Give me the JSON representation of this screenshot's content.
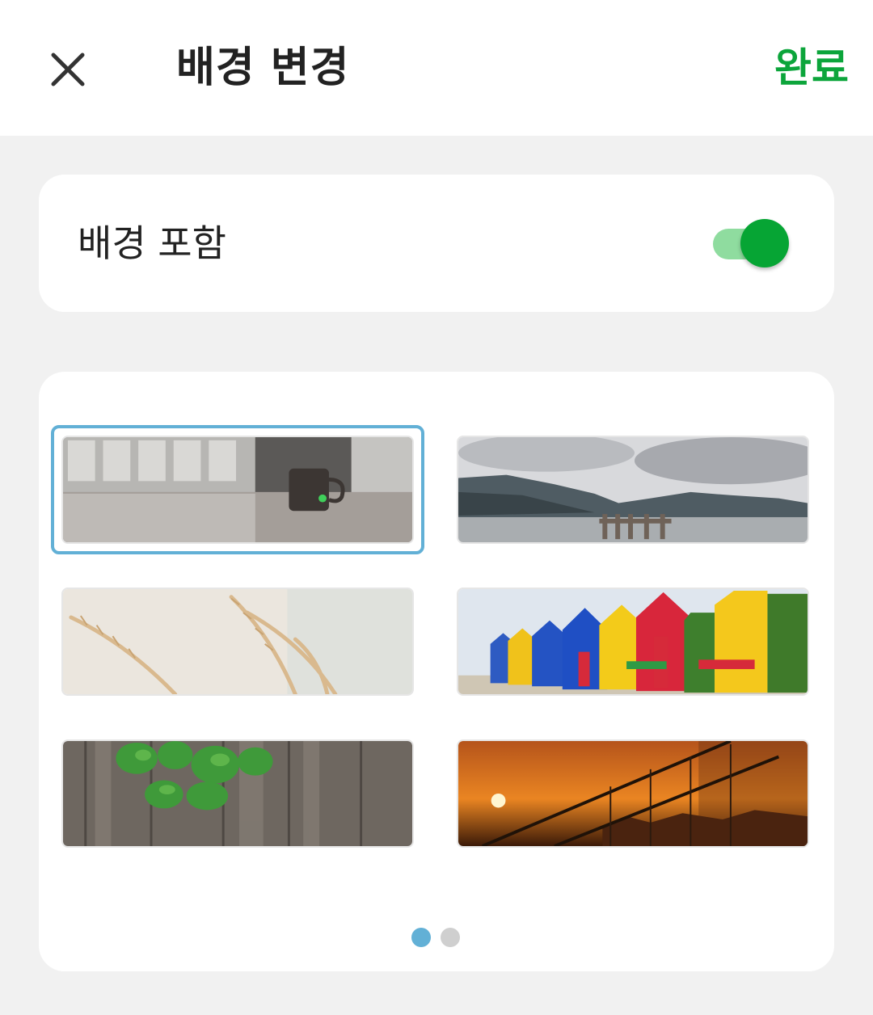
{
  "header": {
    "close_icon": "close-icon",
    "title": "배경 변경",
    "done_label": "완료",
    "done_color": "#0ca53b"
  },
  "include_background": {
    "label": "배경 포함",
    "enabled": true,
    "accent": "#06a534"
  },
  "backgrounds": {
    "selected_index": 0,
    "items": [
      "office-mug",
      "lake-pier",
      "wheat-grass",
      "beach-huts",
      "ivy-wood-fence",
      "sunset-bridge"
    ]
  },
  "pager": {
    "page_count": 2,
    "current_page": 1,
    "active_color": "#62b0d6",
    "inactive_color": "#cfcfcf"
  }
}
